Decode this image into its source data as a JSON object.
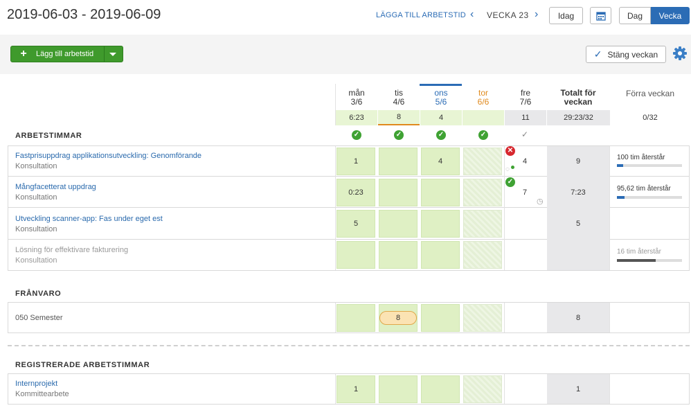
{
  "header": {
    "date_range": "2019-06-03 - 2019-06-09",
    "add_time_link": "LÄGGA TILL ARBETSTID",
    "prev": "‹",
    "week_label": "VECKA 23",
    "next": "›",
    "today_btn": "Idag",
    "view_day": "Dag",
    "view_week": "Vecka"
  },
  "toolbar": {
    "add_btn": "Lägg till arbetstid",
    "close_week_btn": "Stäng veckan"
  },
  "days": [
    {
      "name": "mån",
      "date": "3/6",
      "sum": "6:23"
    },
    {
      "name": "tis",
      "date": "4/6",
      "sum": "8"
    },
    {
      "name": "ons",
      "date": "5/6",
      "sum": "4"
    },
    {
      "name": "tor",
      "date": "6/6",
      "sum": ""
    },
    {
      "name": "fre",
      "date": "7/6",
      "sum": "11"
    }
  ],
  "totals_header": {
    "label": "Totalt för veckan",
    "value": "29:23/32"
  },
  "prev_week_header": {
    "label": "Förra veckan",
    "value": "0/32"
  },
  "sections": {
    "work": "ARBETSTIMMAR",
    "absence": "FRÅNVARO",
    "registered": "REGISTRERADE ARBETSTIMMAR"
  },
  "work_rows": [
    {
      "title": "Fastprisuppdrag applikationsutveckling: Genomförande",
      "sub": "Konsultation",
      "mon": "1",
      "tue": "",
      "wed": "4",
      "fri": "4",
      "total": "9",
      "remaining": "100 tim återstår",
      "progress": 0.1
    },
    {
      "title": "Mångfacetterat uppdrag",
      "sub": "Konsultation",
      "mon": "0:23",
      "tue": "",
      "wed": "",
      "fri": "7",
      "total": "7:23",
      "remaining": "95,62 tim återstår",
      "progress": 0.12
    },
    {
      "title": "Utveckling scanner-app: Fas under eget est",
      "sub": "Konsultation",
      "mon": "5",
      "tue": "",
      "wed": "",
      "fri": "",
      "total": "5",
      "remaining": "",
      "progress": null
    },
    {
      "title": "Lösning för effektivare fakturering",
      "sub": "Konsultation",
      "mon": "",
      "tue": "",
      "wed": "",
      "fri": "",
      "total": "",
      "remaining": "16 tim återstår",
      "progress": 0.6
    }
  ],
  "absence_rows": [
    {
      "title": "050 Semester",
      "tue": "8",
      "total": "8"
    }
  ],
  "registered_rows": [
    {
      "title": "Internprojekt",
      "sub": "Kommittearbete",
      "mon": "1",
      "total": "1"
    }
  ],
  "colors": {
    "accent": "#2b6cb5",
    "green": "#3f9a2c",
    "cell": "#dff0c4",
    "today": "#e08a1e"
  }
}
